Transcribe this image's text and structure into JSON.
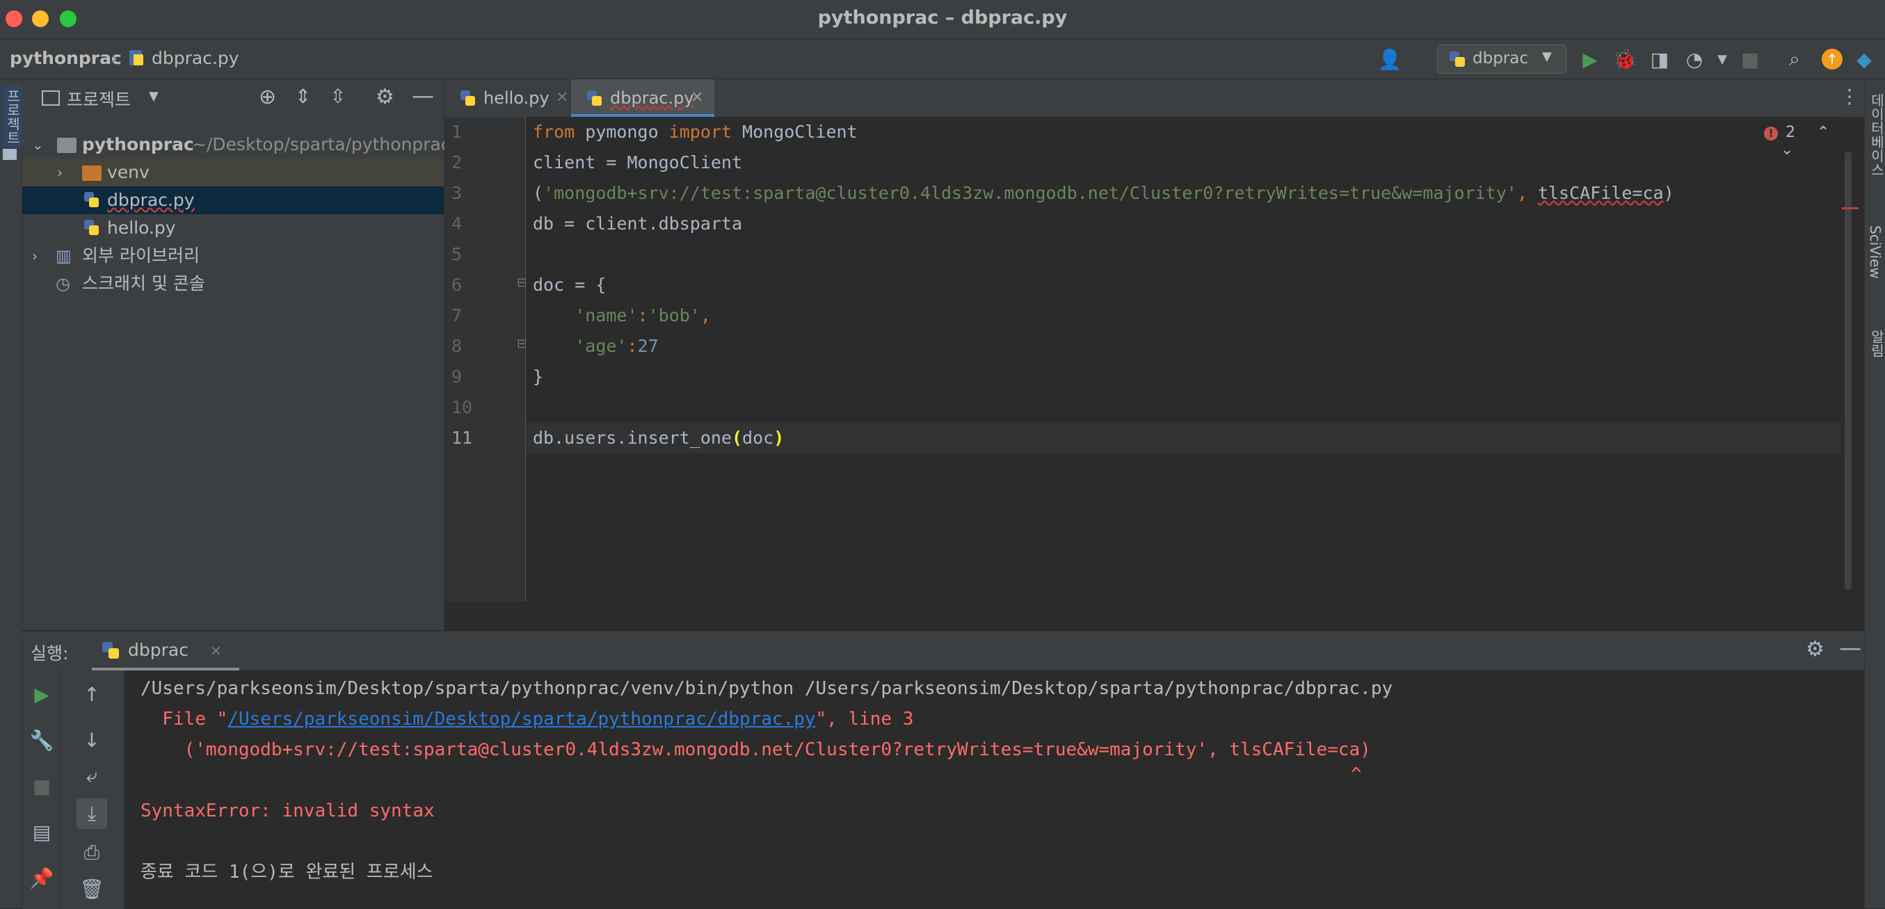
{
  "window": {
    "title": "pythonprac – dbprac.py"
  },
  "breadcrumb": {
    "project": "pythonprac",
    "file": "dbprac.py"
  },
  "toolbar": {
    "run_config": "dbprac"
  },
  "left_strip": {
    "label": "프로젝트"
  },
  "right_strip": {
    "labels": [
      "데이터베이스",
      "SciView",
      "알림"
    ]
  },
  "project_panel": {
    "header": "프로젝트",
    "tree": [
      {
        "name": "pythonprac",
        "path": "~/Desktop/sparta/pythonprac"
      },
      {
        "name": "venv"
      },
      {
        "name": "dbprac.py"
      },
      {
        "name": "hello.py"
      },
      {
        "name": "외부 라이브러리"
      },
      {
        "name": "스크래치 및 콘솔"
      }
    ]
  },
  "tabs": [
    {
      "label": "hello.py"
    },
    {
      "label": "dbprac.py"
    }
  ],
  "editor": {
    "error_count": "2",
    "line_numbers": [
      "1",
      "2",
      "3",
      "4",
      "5",
      "6",
      "7",
      "8",
      "9",
      "10",
      "11"
    ],
    "lines": {
      "l1": {
        "kw1": "from",
        "mid": " pymongo ",
        "kw2": "import",
        "end": " MongoClient"
      },
      "l2": "client = MongoClient",
      "l3": {
        "open": "(",
        "str": "'mongodb+srv://test:sparta@cluster0.4lds3zw.mongodb.net/Cluster0?retryWrites=true&w=majority'",
        "comma": ", ",
        "arg": "tlsCAFile=ca",
        "close": ")"
      },
      "l4": "db = client.dbsparta",
      "l6": "doc = {",
      "l7": {
        "indent": "    ",
        "key": "'name'",
        "colon": ":",
        "val": "'bob'",
        "comma": ","
      },
      "l8": {
        "indent": "    ",
        "key": "'age'",
        "colon": ":",
        "val": "27"
      },
      "l9": "}",
      "l11": {
        "pre": "db.users.insert_one",
        "open": "(",
        "arg": "doc",
        "close": ")"
      }
    }
  },
  "run_panel": {
    "label": "실행:",
    "tab": "dbprac",
    "output": {
      "cmd": "/Users/parkseonsim/Desktop/sparta/pythonprac/venv/bin/python /Users/parkseonsim/Desktop/sparta/pythonprac/dbprac.py",
      "file_pre": "  File \"",
      "file_link": "/Users/parkseonsim/Desktop/sparta/pythonprac/dbprac.py",
      "file_post": "\", line 3",
      "code_line": "    ('mongodb+srv://test:sparta@cluster0.4lds3zw.mongodb.net/Cluster0?retryWrites=true&w=majority', tlsCAFile=ca)",
      "caret": "^",
      "error": "SyntaxError: invalid syntax",
      "exit": "종료 코드 1(으)로 완료된 프로세스"
    }
  },
  "colors": {
    "error_red": "#ff6b68",
    "link_blue": "#287bde",
    "keyword": "#cc7832",
    "string": "#6a8759",
    "number": "#6897bb",
    "run_green": "#499c54"
  }
}
